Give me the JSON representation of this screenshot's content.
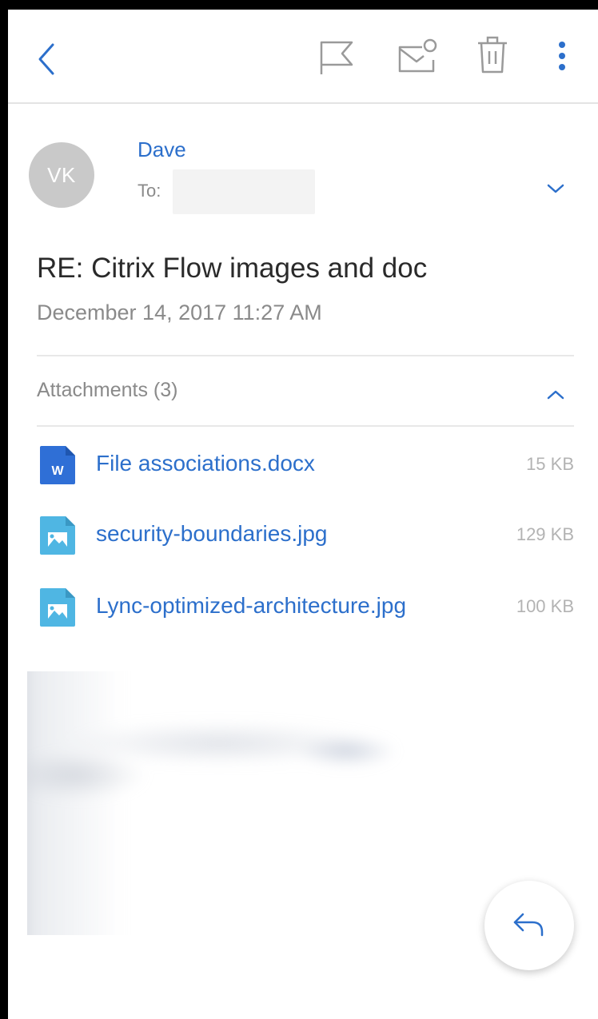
{
  "toolbar": {
    "icons": [
      "back-icon",
      "flag-icon",
      "mark-unread-icon",
      "trash-icon",
      "more-vert-icon"
    ],
    "accent_color": "#2c6fcb",
    "icon_color": "#9a9a9a"
  },
  "sender": {
    "initials": "VK",
    "name": "Dave",
    "to_label": "To:",
    "to_value": ""
  },
  "message": {
    "subject": "RE: Citrix Flow images and doc",
    "date": "December 14, 2017 11:27 AM"
  },
  "attachments": {
    "header": "Attachments (3)",
    "items": [
      {
        "name": "File associations.docx",
        "size": "15 KB",
        "icon": "word-doc-icon",
        "color": "#2f6fd6"
      },
      {
        "name": "security-boundaries.jpg",
        "size": "129 KB",
        "icon": "image-file-icon",
        "color": "#4fb6e3"
      },
      {
        "name": "Lync-optimized-architecture.jpg",
        "size": "100 KB",
        "icon": "image-file-icon",
        "color": "#4fb6e3"
      }
    ]
  },
  "reply": {
    "icon": "reply-icon"
  }
}
